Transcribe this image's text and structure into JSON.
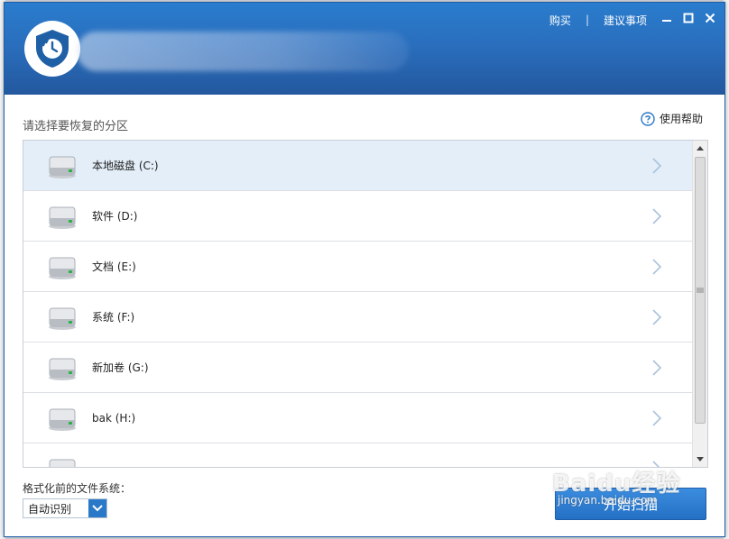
{
  "header": {
    "links": [
      "购买",
      "建议事项"
    ],
    "separator": "|"
  },
  "prompt": "请选择要恢复的分区",
  "help_label": "使用帮助",
  "drives": [
    {
      "label": "本地磁盘 (C:)",
      "selected": true
    },
    {
      "label": "软件 (D:)",
      "selected": false
    },
    {
      "label": "文档 (E:)",
      "selected": false
    },
    {
      "label": "系统 (F:)",
      "selected": false
    },
    {
      "label": "新加卷 (G:)",
      "selected": false
    },
    {
      "label": "bak (H:)",
      "selected": false
    },
    {
      "label": "",
      "selected": false
    }
  ],
  "filesystem": {
    "label": "格式化前的文件系统：",
    "value": "自动识别"
  },
  "start_button": "开始扫描",
  "watermark": {
    "logo": "Baidu经验",
    "url": "jingyan.baidu.com"
  },
  "colors": {
    "title_bar": "#2a6fbe",
    "accent": "#2a78c8",
    "selected_row": "#e3eef8"
  }
}
